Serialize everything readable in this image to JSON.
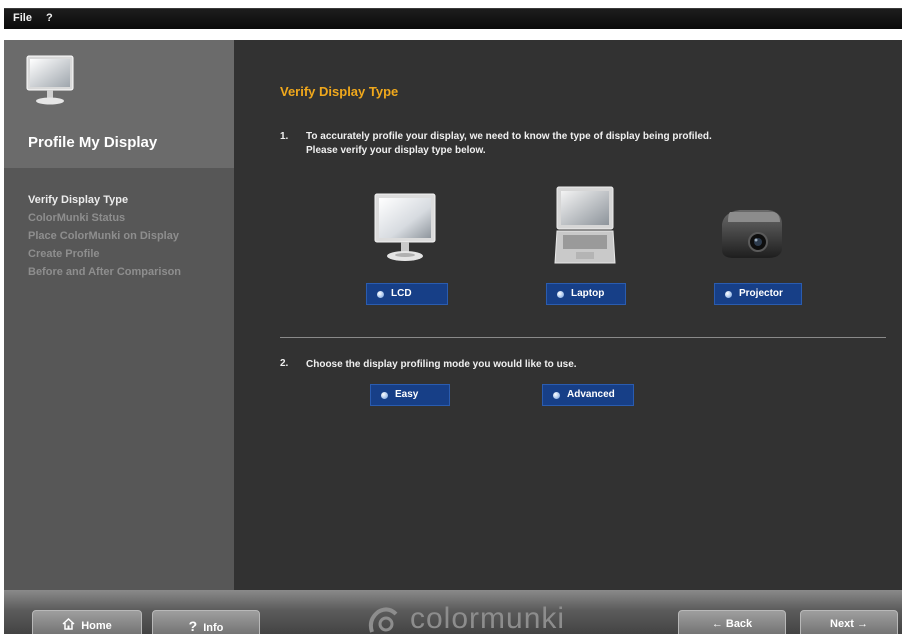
{
  "menu": {
    "file": "File",
    "help": "?"
  },
  "sidebar": {
    "title": "Profile My Display",
    "steps": [
      {
        "label": "Verify Display Type",
        "active": true
      },
      {
        "label": "ColorMunki Status",
        "active": false
      },
      {
        "label": "Place ColorMunki on Display",
        "active": false
      },
      {
        "label": "Create Profile",
        "active": false
      },
      {
        "label": "Before and After Comparison",
        "active": false
      }
    ]
  },
  "main": {
    "title": "Verify Display Type",
    "question1": {
      "number": "1.",
      "line1": "To accurately profile your display, we need to know the type of display being profiled.",
      "line2": "Please verify your display type below."
    },
    "display_types": [
      {
        "label": "LCD",
        "icon": "lcd-monitor-icon"
      },
      {
        "label": "Laptop",
        "icon": "laptop-icon"
      },
      {
        "label": "Projector",
        "icon": "projector-icon"
      }
    ],
    "question2": {
      "number": "2.",
      "text": "Choose the display profiling mode you would like to use."
    },
    "modes": [
      {
        "label": "Easy"
      },
      {
        "label": "Advanced"
      }
    ]
  },
  "footer": {
    "home": "Home",
    "info": "Info",
    "info_icon": "?",
    "brand": "colormunki",
    "back": "← Back",
    "next": "Next →"
  },
  "colors": {
    "accent": "#f0a81c",
    "button_blue": "#173f87",
    "sidebar_bg": "#575757",
    "content_bg": "#323232"
  }
}
